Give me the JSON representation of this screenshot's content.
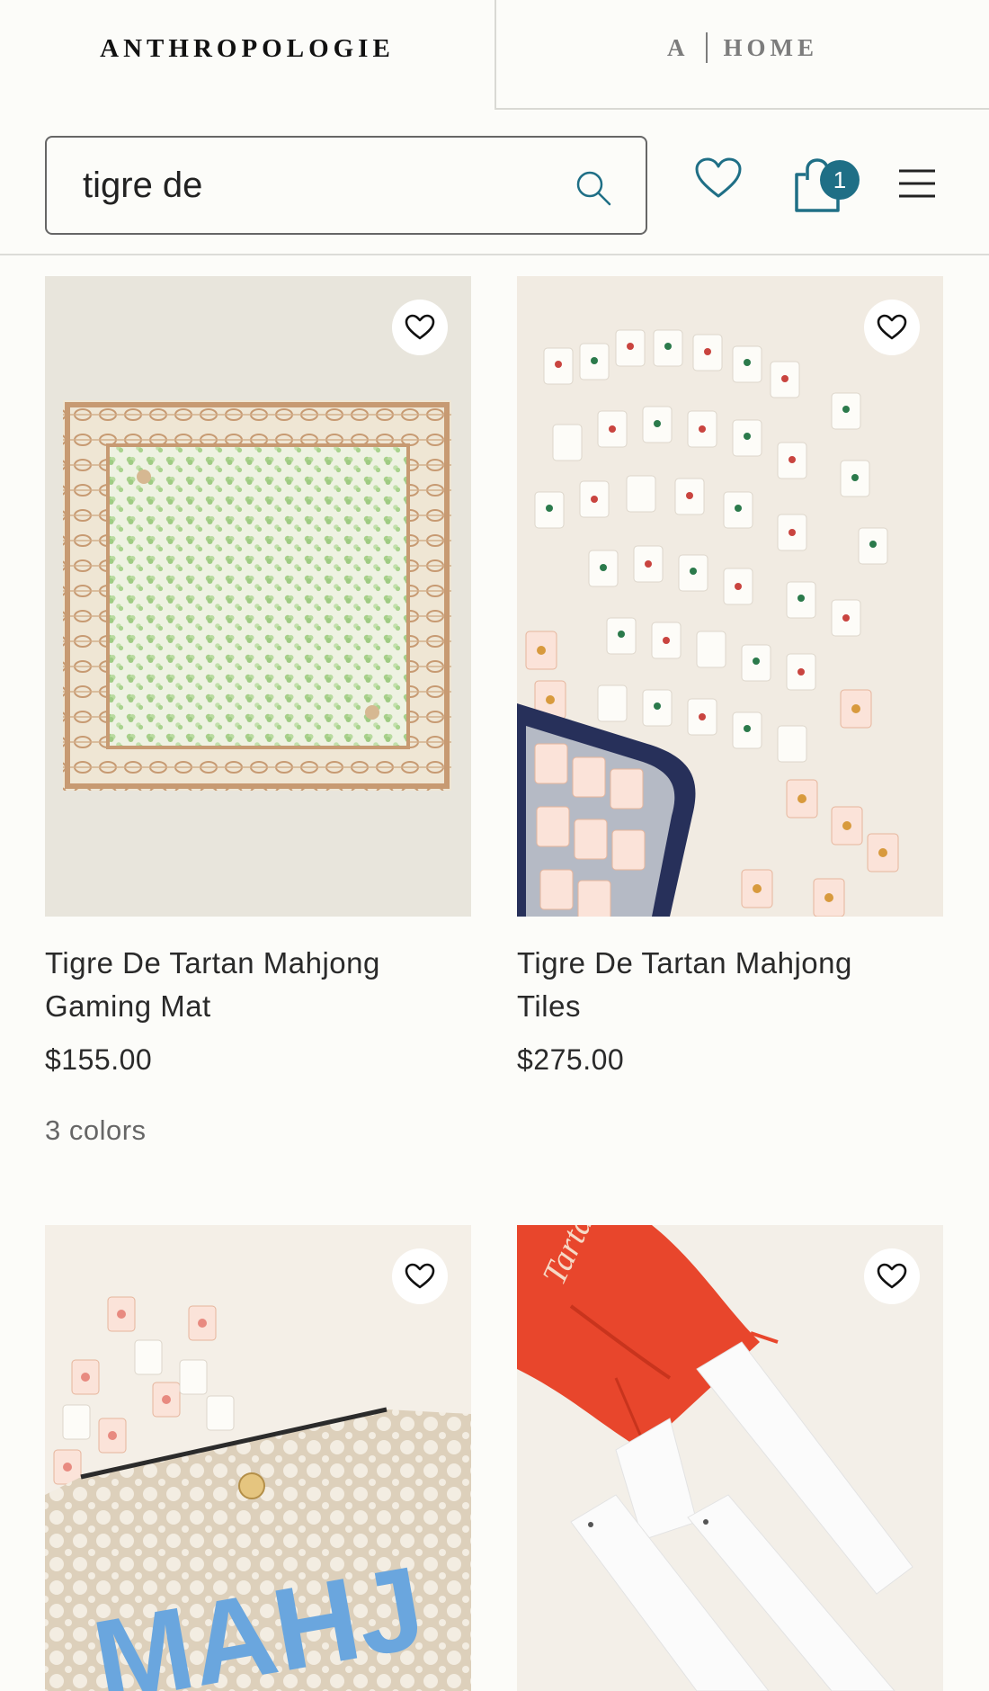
{
  "header": {
    "brand": "ANTHROPOLOGIE",
    "home_prefix": "A",
    "home_label": "HOME"
  },
  "search": {
    "value": "tigre de"
  },
  "cart": {
    "count": "1"
  },
  "icons": {
    "search": "search-icon",
    "wishlist": "heart-icon",
    "cart": "shopping-bag-icon",
    "menu": "hamburger-menu-icon",
    "favorite": "heart-icon"
  },
  "colors": {
    "accent": "#1f6f86",
    "background": "#fcfcf9"
  },
  "products": [
    {
      "name_line1": "Tigre De Tartan Mahjong",
      "name_line2": "Gaming Mat",
      "price": "$155.00",
      "colors": "3 colors"
    },
    {
      "name_line1": "Tigre De Tartan Mahjong",
      "name_line2": "Tiles",
      "price": "$275.00"
    },
    {
      "image_text": "MAHJ"
    },
    {
      "image_text": "Tartan"
    }
  ]
}
